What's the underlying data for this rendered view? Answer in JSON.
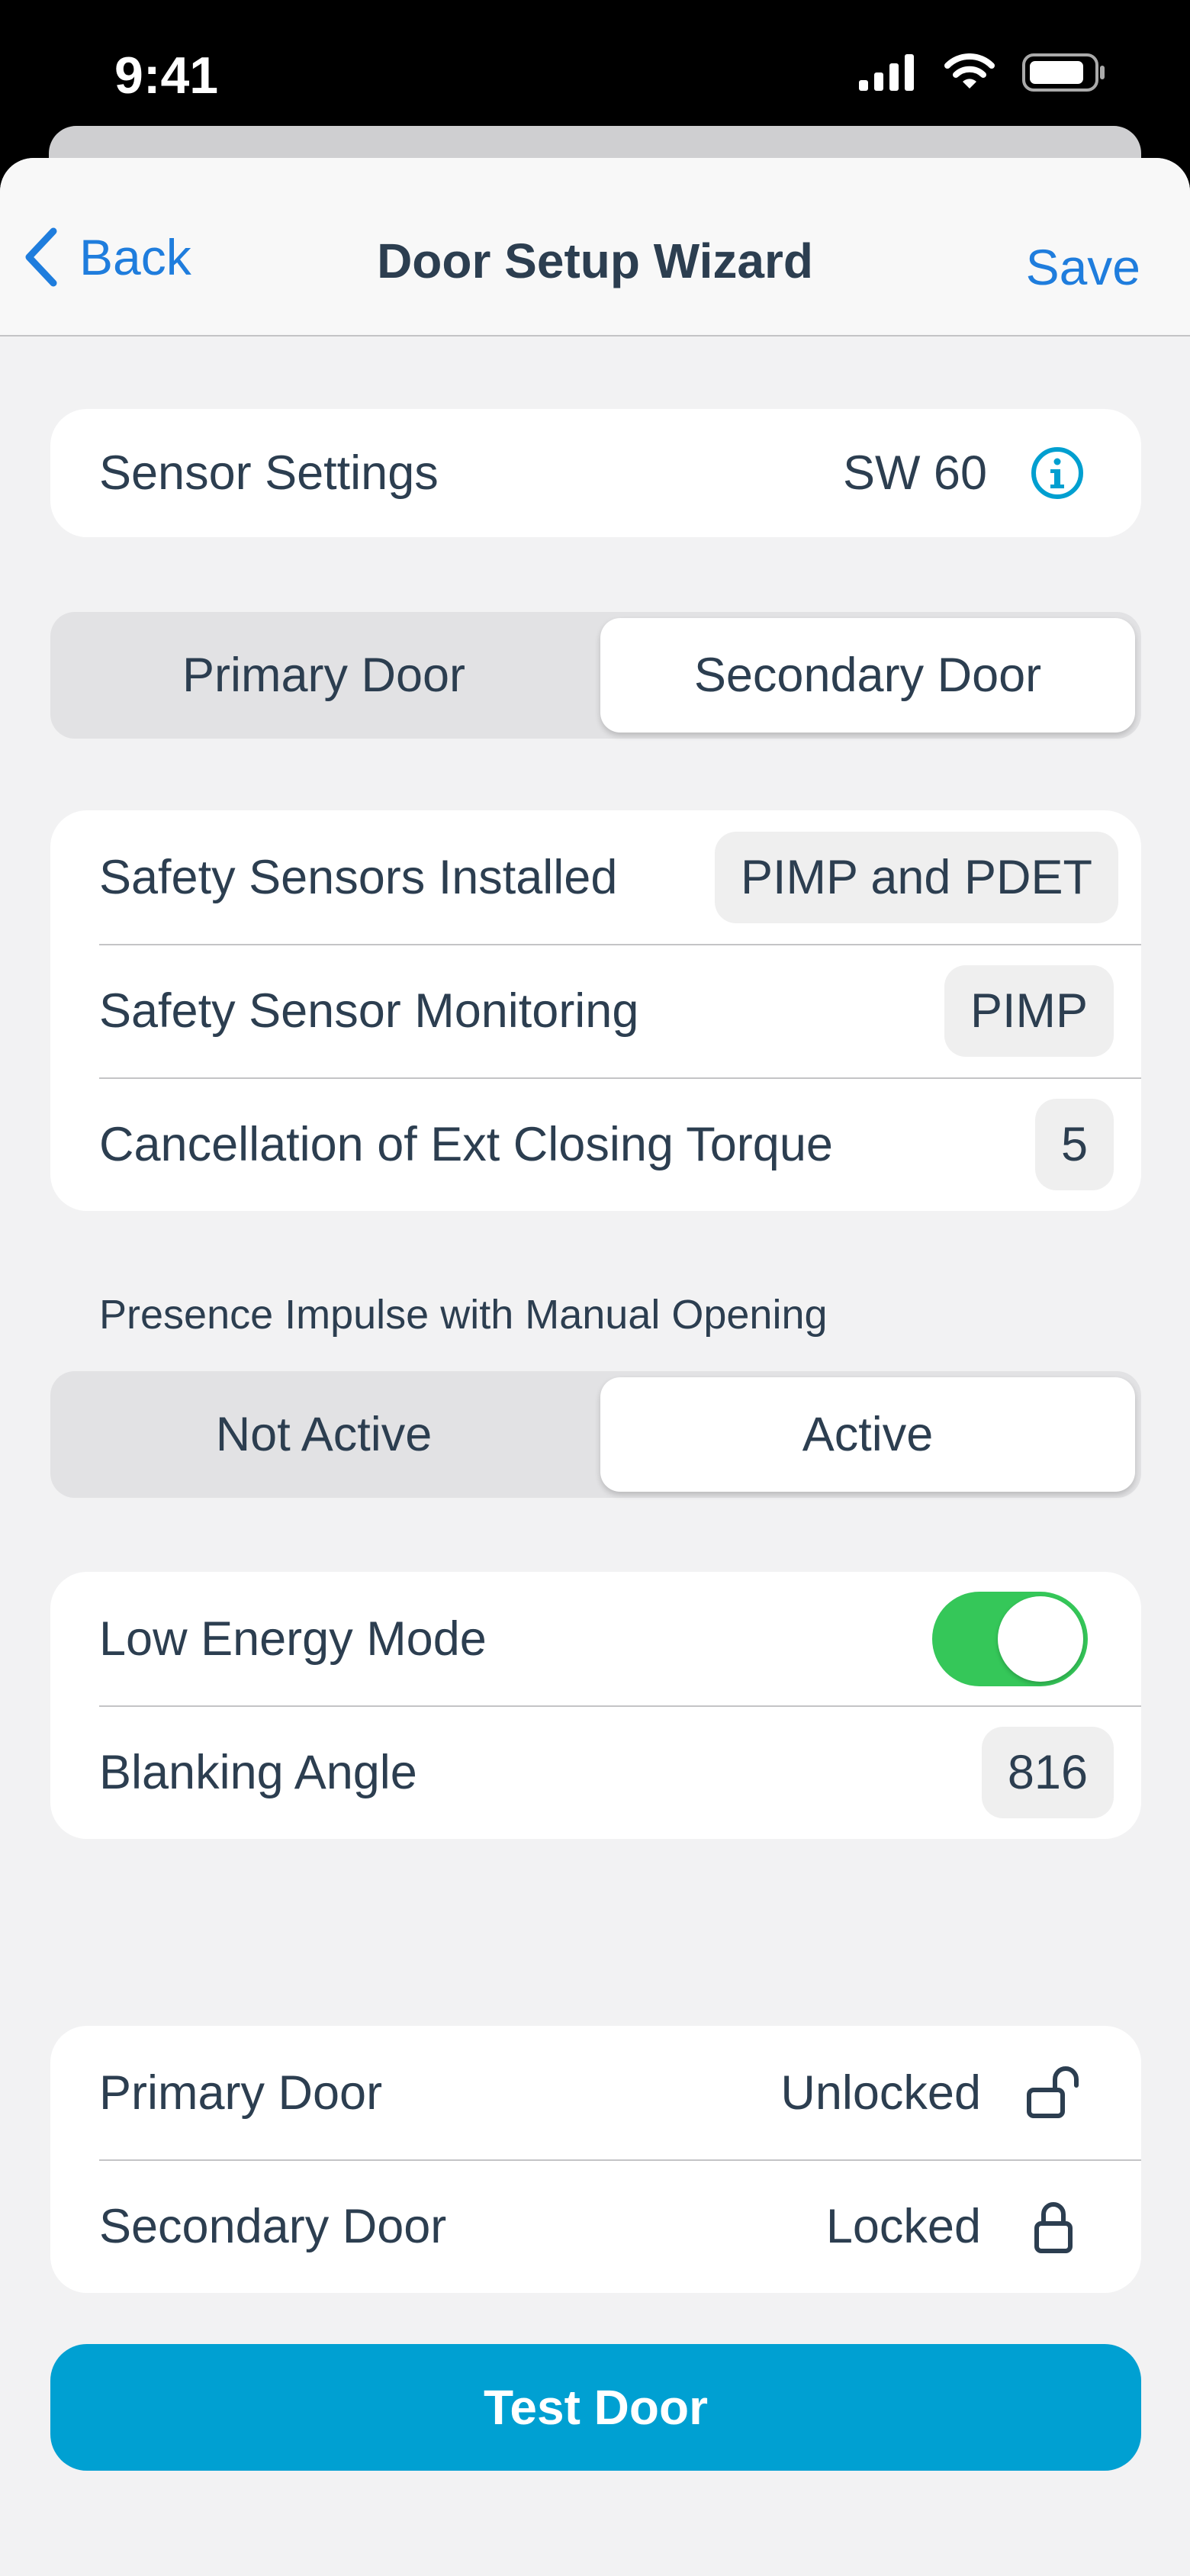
{
  "status_bar": {
    "time": "9:41"
  },
  "nav": {
    "back_label": "Back",
    "title": "Door Setup Wizard",
    "save_label": "Save"
  },
  "sensor_settings": {
    "label": "Sensor Settings",
    "value": "SW 60",
    "icon": "info-icon"
  },
  "door_selector": {
    "options": [
      "Primary Door",
      "Secondary Door"
    ],
    "selected": "Secondary Door"
  },
  "safety": {
    "rows": [
      {
        "label": "Safety Sensors Installed",
        "value": "PIMP and PDET"
      },
      {
        "label": "Safety Sensor Monitoring",
        "value": "PIMP"
      },
      {
        "label": "Cancellation of Ext Closing Torque",
        "value": "5"
      }
    ]
  },
  "presence_impulse": {
    "label": "Presence Impulse with Manual Opening",
    "options": [
      "Not Active",
      "Active"
    ],
    "selected": "Active"
  },
  "energy": {
    "low_energy_label": "Low Energy Mode",
    "low_energy_on": true,
    "blanking_label": "Blanking Angle",
    "blanking_value": "816"
  },
  "door_status": {
    "rows": [
      {
        "label": "Primary Door",
        "value": "Unlocked",
        "icon": "unlocked-padlock-icon"
      },
      {
        "label": "Secondary Door",
        "value": "Locked",
        "icon": "locked-padlock-icon"
      }
    ]
  },
  "actions": {
    "test_door_label": "Test Door"
  },
  "colors": {
    "accent": "#1f7ddd",
    "primary_button": "#00a0d2",
    "toggle_on": "#35c759",
    "info_icon": "#009fd0"
  }
}
